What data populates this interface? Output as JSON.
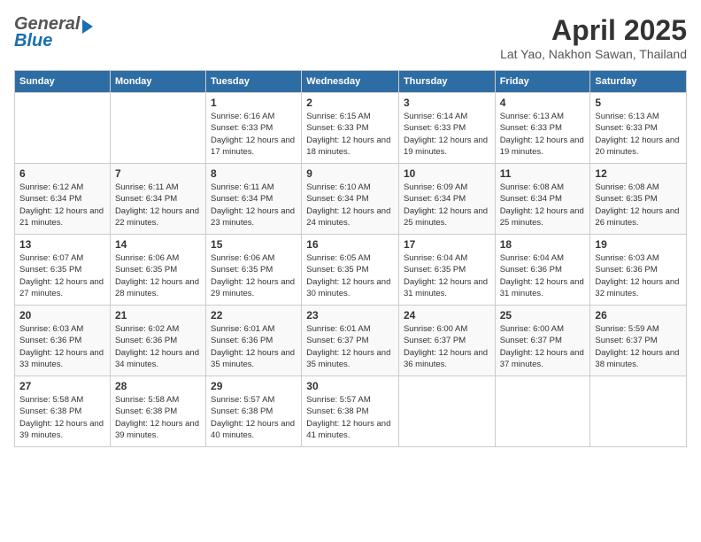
{
  "header": {
    "logo_general": "General",
    "logo_blue": "Blue",
    "month_title": "April 2025",
    "location": "Lat Yao, Nakhon Sawan, Thailand"
  },
  "weekdays": [
    "Sunday",
    "Monday",
    "Tuesday",
    "Wednesday",
    "Thursday",
    "Friday",
    "Saturday"
  ],
  "weeks": [
    [
      {
        "day": "",
        "sunrise": "",
        "sunset": "",
        "daylight": ""
      },
      {
        "day": "",
        "sunrise": "",
        "sunset": "",
        "daylight": ""
      },
      {
        "day": "1",
        "sunrise": "Sunrise: 6:16 AM",
        "sunset": "Sunset: 6:33 PM",
        "daylight": "Daylight: 12 hours and 17 minutes."
      },
      {
        "day": "2",
        "sunrise": "Sunrise: 6:15 AM",
        "sunset": "Sunset: 6:33 PM",
        "daylight": "Daylight: 12 hours and 18 minutes."
      },
      {
        "day": "3",
        "sunrise": "Sunrise: 6:14 AM",
        "sunset": "Sunset: 6:33 PM",
        "daylight": "Daylight: 12 hours and 19 minutes."
      },
      {
        "day": "4",
        "sunrise": "Sunrise: 6:13 AM",
        "sunset": "Sunset: 6:33 PM",
        "daylight": "Daylight: 12 hours and 19 minutes."
      },
      {
        "day": "5",
        "sunrise": "Sunrise: 6:13 AM",
        "sunset": "Sunset: 6:33 PM",
        "daylight": "Daylight: 12 hours and 20 minutes."
      }
    ],
    [
      {
        "day": "6",
        "sunrise": "Sunrise: 6:12 AM",
        "sunset": "Sunset: 6:34 PM",
        "daylight": "Daylight: 12 hours and 21 minutes."
      },
      {
        "day": "7",
        "sunrise": "Sunrise: 6:11 AM",
        "sunset": "Sunset: 6:34 PM",
        "daylight": "Daylight: 12 hours and 22 minutes."
      },
      {
        "day": "8",
        "sunrise": "Sunrise: 6:11 AM",
        "sunset": "Sunset: 6:34 PM",
        "daylight": "Daylight: 12 hours and 23 minutes."
      },
      {
        "day": "9",
        "sunrise": "Sunrise: 6:10 AM",
        "sunset": "Sunset: 6:34 PM",
        "daylight": "Daylight: 12 hours and 24 minutes."
      },
      {
        "day": "10",
        "sunrise": "Sunrise: 6:09 AM",
        "sunset": "Sunset: 6:34 PM",
        "daylight": "Daylight: 12 hours and 25 minutes."
      },
      {
        "day": "11",
        "sunrise": "Sunrise: 6:08 AM",
        "sunset": "Sunset: 6:34 PM",
        "daylight": "Daylight: 12 hours and 25 minutes."
      },
      {
        "day": "12",
        "sunrise": "Sunrise: 6:08 AM",
        "sunset": "Sunset: 6:35 PM",
        "daylight": "Daylight: 12 hours and 26 minutes."
      }
    ],
    [
      {
        "day": "13",
        "sunrise": "Sunrise: 6:07 AM",
        "sunset": "Sunset: 6:35 PM",
        "daylight": "Daylight: 12 hours and 27 minutes."
      },
      {
        "day": "14",
        "sunrise": "Sunrise: 6:06 AM",
        "sunset": "Sunset: 6:35 PM",
        "daylight": "Daylight: 12 hours and 28 minutes."
      },
      {
        "day": "15",
        "sunrise": "Sunrise: 6:06 AM",
        "sunset": "Sunset: 6:35 PM",
        "daylight": "Daylight: 12 hours and 29 minutes."
      },
      {
        "day": "16",
        "sunrise": "Sunrise: 6:05 AM",
        "sunset": "Sunset: 6:35 PM",
        "daylight": "Daylight: 12 hours and 30 minutes."
      },
      {
        "day": "17",
        "sunrise": "Sunrise: 6:04 AM",
        "sunset": "Sunset: 6:35 PM",
        "daylight": "Daylight: 12 hours and 31 minutes."
      },
      {
        "day": "18",
        "sunrise": "Sunrise: 6:04 AM",
        "sunset": "Sunset: 6:36 PM",
        "daylight": "Daylight: 12 hours and 31 minutes."
      },
      {
        "day": "19",
        "sunrise": "Sunrise: 6:03 AM",
        "sunset": "Sunset: 6:36 PM",
        "daylight": "Daylight: 12 hours and 32 minutes."
      }
    ],
    [
      {
        "day": "20",
        "sunrise": "Sunrise: 6:03 AM",
        "sunset": "Sunset: 6:36 PM",
        "daylight": "Daylight: 12 hours and 33 minutes."
      },
      {
        "day": "21",
        "sunrise": "Sunrise: 6:02 AM",
        "sunset": "Sunset: 6:36 PM",
        "daylight": "Daylight: 12 hours and 34 minutes."
      },
      {
        "day": "22",
        "sunrise": "Sunrise: 6:01 AM",
        "sunset": "Sunset: 6:36 PM",
        "daylight": "Daylight: 12 hours and 35 minutes."
      },
      {
        "day": "23",
        "sunrise": "Sunrise: 6:01 AM",
        "sunset": "Sunset: 6:37 PM",
        "daylight": "Daylight: 12 hours and 35 minutes."
      },
      {
        "day": "24",
        "sunrise": "Sunrise: 6:00 AM",
        "sunset": "Sunset: 6:37 PM",
        "daylight": "Daylight: 12 hours and 36 minutes."
      },
      {
        "day": "25",
        "sunrise": "Sunrise: 6:00 AM",
        "sunset": "Sunset: 6:37 PM",
        "daylight": "Daylight: 12 hours and 37 minutes."
      },
      {
        "day": "26",
        "sunrise": "Sunrise: 5:59 AM",
        "sunset": "Sunset: 6:37 PM",
        "daylight": "Daylight: 12 hours and 38 minutes."
      }
    ],
    [
      {
        "day": "27",
        "sunrise": "Sunrise: 5:58 AM",
        "sunset": "Sunset: 6:38 PM",
        "daylight": "Daylight: 12 hours and 39 minutes."
      },
      {
        "day": "28",
        "sunrise": "Sunrise: 5:58 AM",
        "sunset": "Sunset: 6:38 PM",
        "daylight": "Daylight: 12 hours and 39 minutes."
      },
      {
        "day": "29",
        "sunrise": "Sunrise: 5:57 AM",
        "sunset": "Sunset: 6:38 PM",
        "daylight": "Daylight: 12 hours and 40 minutes."
      },
      {
        "day": "30",
        "sunrise": "Sunrise: 5:57 AM",
        "sunset": "Sunset: 6:38 PM",
        "daylight": "Daylight: 12 hours and 41 minutes."
      },
      {
        "day": "",
        "sunrise": "",
        "sunset": "",
        "daylight": ""
      },
      {
        "day": "",
        "sunrise": "",
        "sunset": "",
        "daylight": ""
      },
      {
        "day": "",
        "sunrise": "",
        "sunset": "",
        "daylight": ""
      }
    ]
  ]
}
